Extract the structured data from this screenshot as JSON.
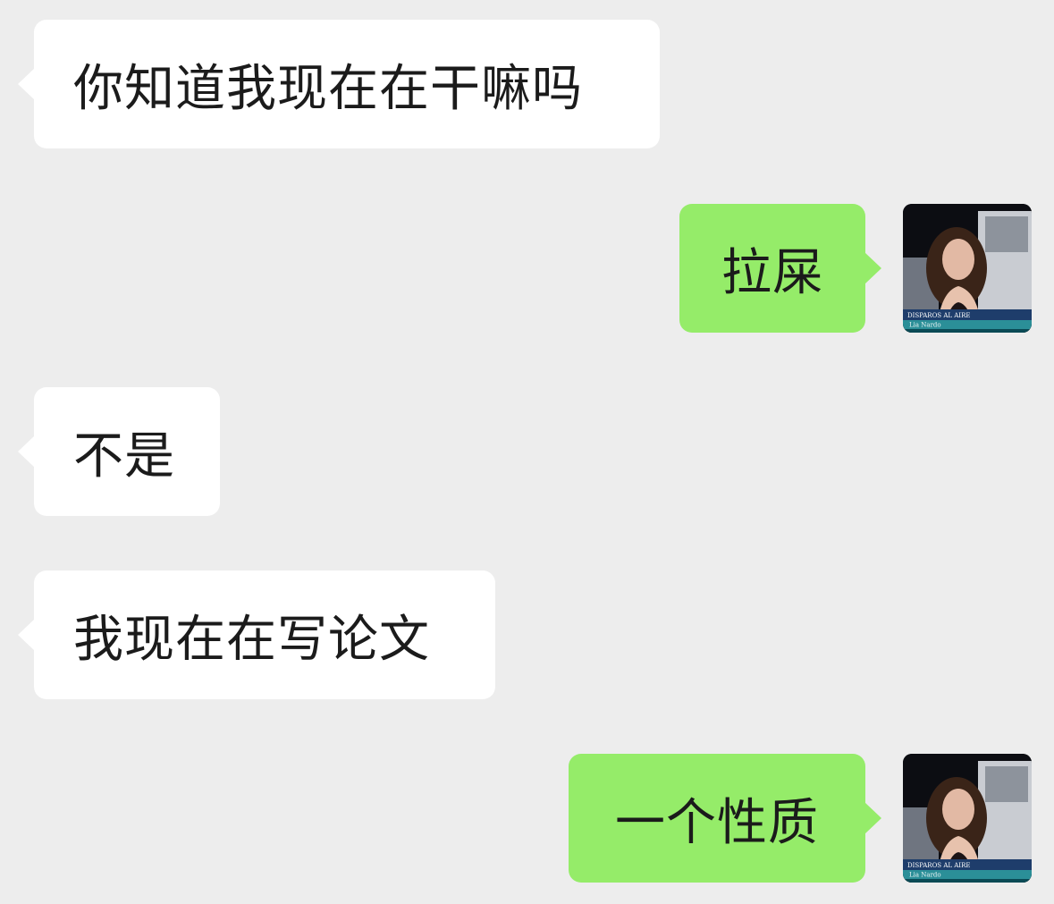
{
  "messages": [
    {
      "side": "in",
      "text": "你知道我现在在干嘛吗"
    },
    {
      "side": "out",
      "text": "拉屎"
    },
    {
      "side": "in",
      "text": "不是"
    },
    {
      "side": "in",
      "text": "我现在在写论文"
    },
    {
      "side": "out",
      "text": "一个性质"
    }
  ],
  "avatar": {
    "caption_title": "DISPAROS AL AIRE",
    "caption_name": "Lia Nardo"
  },
  "colors": {
    "background": "#ededed",
    "incoming_bubble": "#ffffff",
    "outgoing_bubble": "#95ec69",
    "text": "#1b1b1b"
  }
}
